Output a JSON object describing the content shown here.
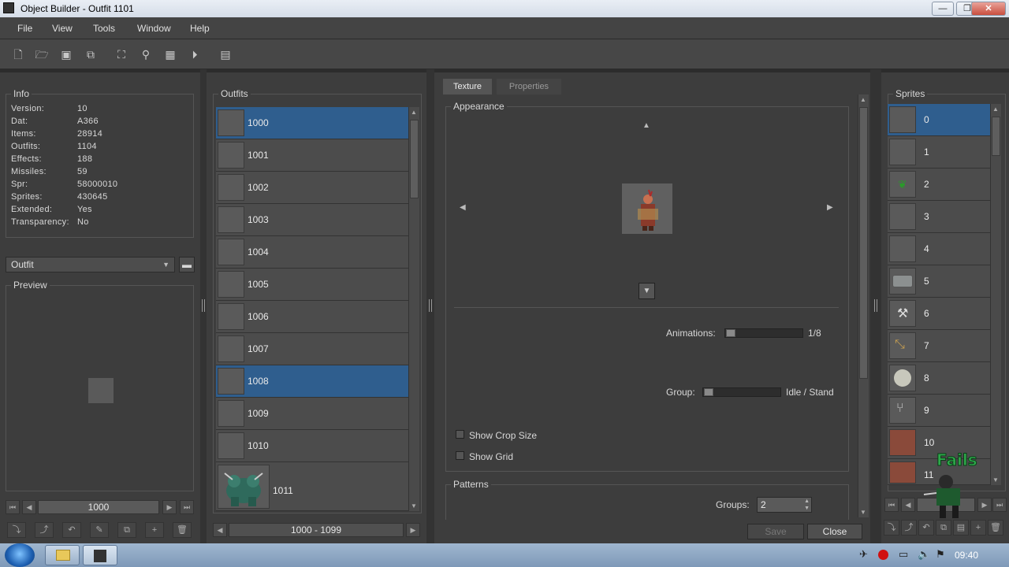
{
  "window": {
    "title": "Object Builder - Outfit 1101"
  },
  "menu": [
    "File",
    "View",
    "Tools",
    "Window",
    "Help"
  ],
  "info": {
    "title": "Info",
    "rows": [
      {
        "key": "Version:",
        "value": "10"
      },
      {
        "key": "Dat:",
        "value": "A366"
      },
      {
        "key": "Items:",
        "value": "28914"
      },
      {
        "key": "Outfits:",
        "value": "1104"
      },
      {
        "key": "Effects:",
        "value": "188"
      },
      {
        "key": "Missiles:",
        "value": "59"
      },
      {
        "key": "Spr:",
        "value": "58000010"
      },
      {
        "key": "Sprites:",
        "value": "430645"
      },
      {
        "key": "Extended:",
        "value": "Yes"
      },
      {
        "key": "Transparency:",
        "value": "No"
      }
    ]
  },
  "category_select": {
    "value": "Outfit"
  },
  "preview": {
    "title": "Preview"
  },
  "left_nav": {
    "value": "1000"
  },
  "outfits": {
    "title": "Outfits",
    "items": [
      {
        "id": "1000",
        "selected": true
      },
      {
        "id": "1001",
        "selected": false
      },
      {
        "id": "1002",
        "selected": false
      },
      {
        "id": "1003",
        "selected": false
      },
      {
        "id": "1004",
        "selected": false
      },
      {
        "id": "1005",
        "selected": false
      },
      {
        "id": "1006",
        "selected": false
      },
      {
        "id": "1007",
        "selected": false
      },
      {
        "id": "1008",
        "selected": true
      },
      {
        "id": "1009",
        "selected": false
      },
      {
        "id": "1010",
        "selected": false
      },
      {
        "id": "1011",
        "selected": false
      }
    ],
    "range": "1000 - 1099"
  },
  "editor": {
    "tabs": [
      "Texture",
      "Properties"
    ],
    "active_tab": "Texture",
    "appearance_title": "Appearance",
    "animations_label": "Animations:",
    "animations_value": "1/8",
    "group_label": "Group:",
    "group_value": "Idle / Stand",
    "show_crop_size": "Show Crop Size",
    "show_grid": "Show Grid",
    "patterns_title": "Patterns",
    "groups_label": "Groups:",
    "groups_value": "2",
    "save_label": "Save",
    "close_label": "Close"
  },
  "sprites": {
    "title": "Sprites",
    "items": [
      "0",
      "1",
      "2",
      "3",
      "4",
      "5",
      "6",
      "7",
      "8",
      "9",
      "10",
      "11"
    ]
  },
  "overlay": {
    "text": "Fails"
  },
  "taskbar": {
    "clock": "09:40"
  },
  "colors": {
    "selection": "#2f5e8e",
    "panel": "#3d3d3d",
    "accent_text": "#2ea84a"
  }
}
